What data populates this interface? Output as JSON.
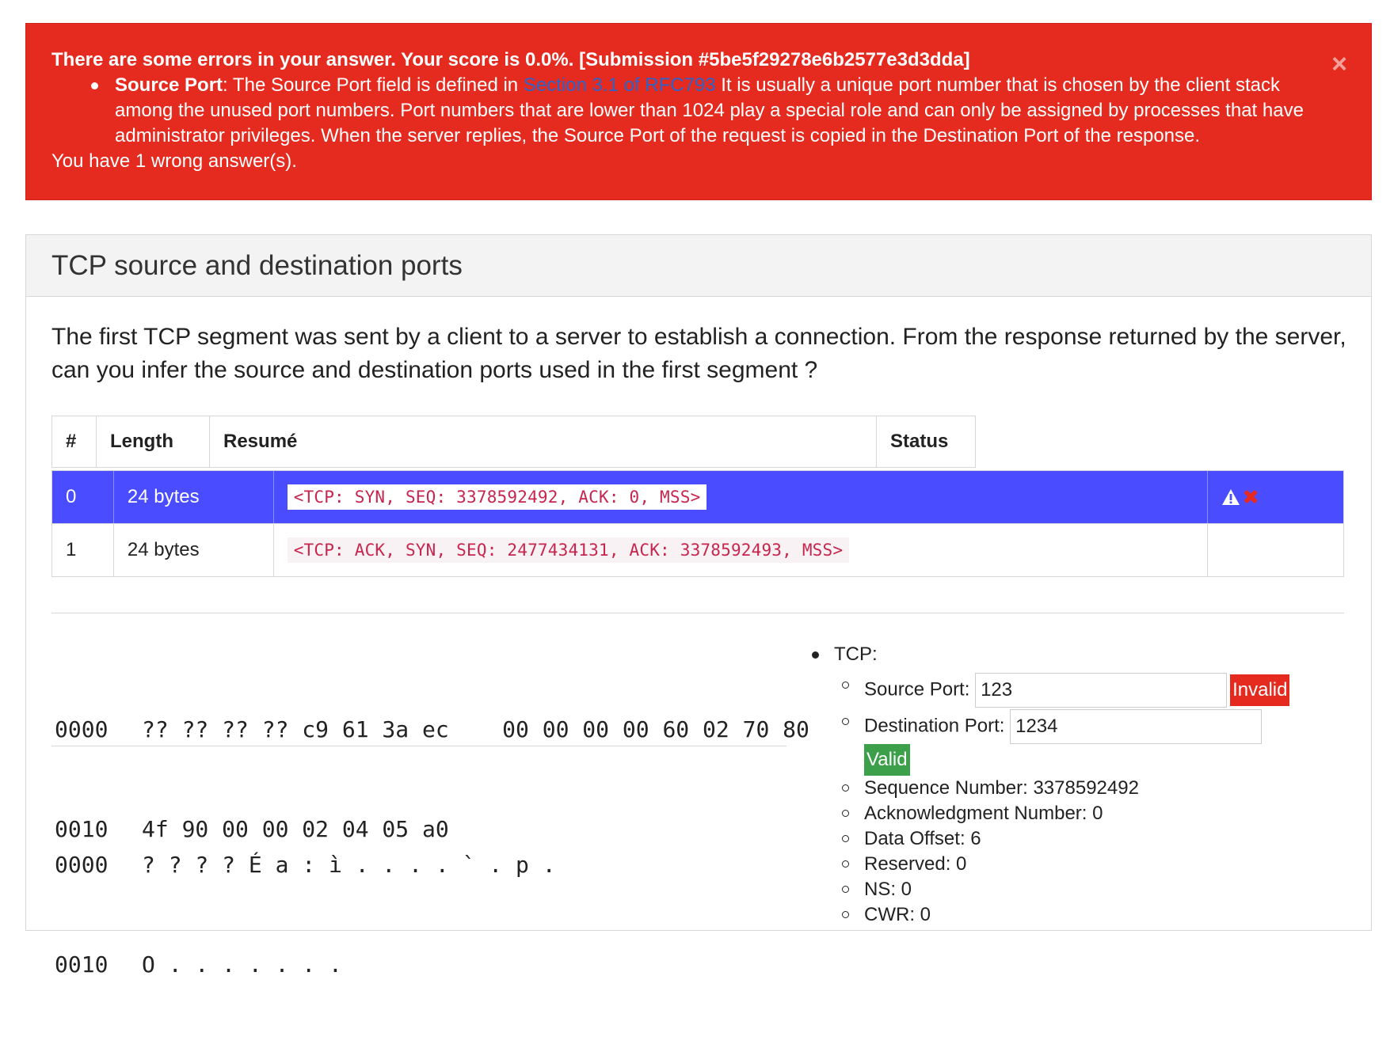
{
  "alert": {
    "headline": "There are some errors in your answer. Your score is 0.0%. [Submission #5be5f29278e6b2577e3d3dda]",
    "close_glyph": "×",
    "item": {
      "field": "Source Port",
      "text_before": ": The Source Port field is defined in ",
      "link_text": "Section 3.1 of RFC793",
      "text_after": " It is usually a unique port number that is chosen by the client stack among the unused port numbers. Port numbers that are lower than 1024 play a special role and can only be assigned by processes that have administrator privileges. When the server replies, the Source Port of the request is copied in the Destination Port of the response."
    },
    "footer": "You have 1 wrong answer(s)."
  },
  "panel": {
    "title": "TCP source and destination ports",
    "question": "The first TCP segment was sent by a client to a server to establish a connection. From the response returned by the server, can you infer the source and destination ports used in the first segment ?"
  },
  "table": {
    "headers": [
      "#",
      "Length",
      "Resumé",
      "Status"
    ],
    "rows": [
      {
        "index": "0",
        "length": "24 bytes",
        "summary": "<TCP: SYN, SEQ: 3378592492, ACK: 0, MSS>",
        "status_icons": [
          "warning-icon",
          "error-x-icon"
        ],
        "status_glyph": "✖"
      },
      {
        "index": "1",
        "length": "24 bytes",
        "summary": "<TCP: ACK, SYN, SEQ: 2477434131, ACK: 3378592493, MSS>",
        "status_icons": []
      }
    ]
  },
  "hexdump": [
    {
      "offset": "0000",
      "bytes": "?? ?? ?? ?? c9 61 3a ec    00 00 00 00 60 02 70 80"
    },
    {
      "offset": "0010",
      "bytes": "4f 90 00 00 02 04 05 a0"
    }
  ],
  "asciidump": [
    {
      "offset": "0000",
      "chars": "? ? ? ? É a : ì . . . . ` . p ."
    },
    {
      "offset": "0010",
      "chars": "O . . . . . . ."
    }
  ],
  "tcp": {
    "label": "TCP:",
    "source_port": {
      "label": "Source Port:",
      "value": "123",
      "result": "Invalid"
    },
    "destination_port": {
      "label": "Destination Port:",
      "value": "1234",
      "result": "Valid"
    },
    "fields": [
      "Sequence Number: 3378592492",
      "Acknowledgment Number: 0",
      "Data Offset: 6",
      "Reserved: 0",
      "NS: 0",
      "CWR: 0"
    ]
  },
  "colors": {
    "alert_bg": "#e52b1f",
    "selected_row": "#4a4cff",
    "invalid": "#e52b1f",
    "valid": "#3c9f4a",
    "code_text": "#c7254e"
  }
}
